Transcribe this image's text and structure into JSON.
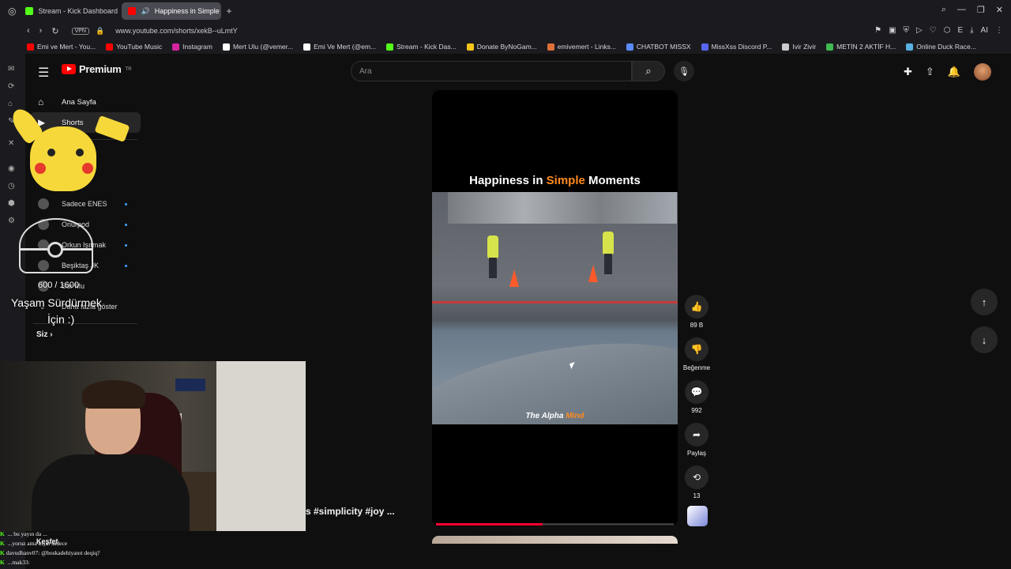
{
  "browser": {
    "tabs": [
      {
        "label": "Stream - Kick Dashboard",
        "active": false,
        "color": "#53fc18"
      },
      {
        "label": "Happiness in Simple M",
        "active": true,
        "color": "#ff0000"
      }
    ],
    "vpn": "VPN",
    "url": "www.youtube.com/shorts/xekB--uLmtY",
    "bookmarks": [
      {
        "label": "Emi ve Mert - You...",
        "color": "#ff0000"
      },
      {
        "label": "YouTube Music",
        "color": "#ff0000"
      },
      {
        "label": "Instagram",
        "color": "#d6249f"
      },
      {
        "label": "Mert Ulu (@vemer...",
        "color": "#ffffff"
      },
      {
        "label": "Emi Ve Mert (@em...",
        "color": "#ffffff"
      },
      {
        "label": "Stream - Kick Das...",
        "color": "#53fc18"
      },
      {
        "label": "Donate ByNoGam...",
        "color": "#f5c518"
      },
      {
        "label": "emivemert - Links...",
        "color": "#e0703a"
      },
      {
        "label": "CHATBOT MISSX",
        "color": "#5a8cff"
      },
      {
        "label": "MissXss Discord P...",
        "color": "#5865f2"
      },
      {
        "label": "Ivir Zivir",
        "color": "#cccccc"
      },
      {
        "label": "METİN 2 AKTİF H...",
        "color": "#3fb950"
      },
      {
        "label": "Online Duck Race...",
        "color": "#5ab0e0"
      }
    ]
  },
  "youtube": {
    "logo_text": "Premium",
    "logo_sup": "TR",
    "search_placeholder": "Ara",
    "sidebar": {
      "items": [
        {
          "label": "Ana Sayfa",
          "icon": "home-icon"
        },
        {
          "label": "Shorts",
          "icon": "shorts-icon",
          "active": true
        }
      ],
      "subscriptions": [
        "Sadece ENES",
        "Onurpod",
        "Orkun Işıtmak",
        "Beşiktaş JK",
        "Sur Mu"
      ],
      "more_label": "Daha fazla göster",
      "siz_label": "Siz",
      "kesfet_label": "Keşfet"
    },
    "short": {
      "title_before": "Happiness in ",
      "title_highlight": "Simple",
      "title_after": " Moments",
      "watermark_before": "The Alpha ",
      "watermark_highlight": "Mind",
      "progress": 0.45,
      "hashtags": "s #simplicity #joy ..."
    },
    "actions": {
      "like_count": "89 B",
      "dislike_label": "Beğenme",
      "comment_count": "992",
      "share_label": "Paylaş",
      "remix_count": "13"
    }
  },
  "overlay": {
    "counter": "600 / 1600",
    "goal_line1": "Yaşam Sürdürmek",
    "goal_line2": "İçin :)"
  },
  "chat": [
    {
      "user": "",
      "text": "... bu yayın da ..."
    },
    {
      "user": "",
      "text": "...yoruz ama kışın sadece"
    },
    {
      "user": "davudhanv07:",
      "text": "@boskadehiyanıt deqiq?"
    },
    {
      "user": "",
      "text": "...mak33:"
    }
  ]
}
